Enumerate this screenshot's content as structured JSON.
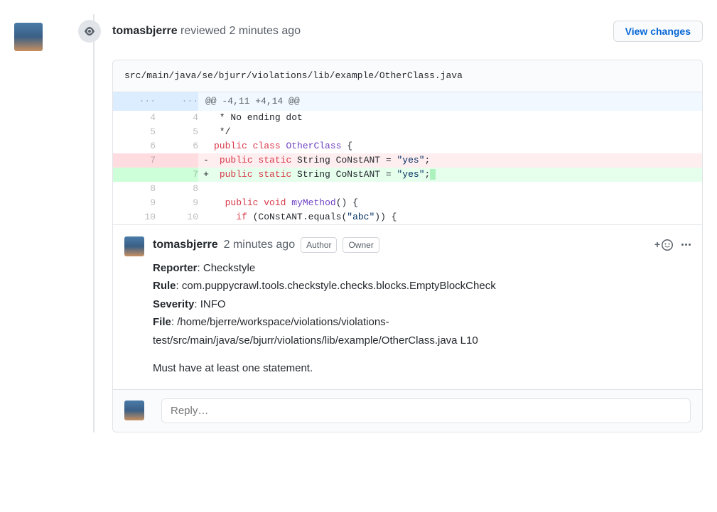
{
  "header": {
    "username": "tomasbjerre",
    "action": "reviewed",
    "time": "2 minutes ago",
    "viewChanges": "View changes"
  },
  "diff": {
    "filePath": "src/main/java/se/bjurr/violations/lib/example/OtherClass.java",
    "hunkEllipsis": "...",
    "hunkHeader": "@@ -4,11 +4,14 @@",
    "lines": [
      {
        "o": "4",
        "n": "4",
        "m": "",
        "t": "context",
        "parts": [
          " * No ending dot"
        ]
      },
      {
        "o": "5",
        "n": "5",
        "m": "",
        "t": "context",
        "parts": [
          " */"
        ]
      },
      {
        "o": "6",
        "n": "6",
        "m": "",
        "t": "context",
        "parts": [
          [
            "public",
            "k-public"
          ],
          [
            " ",
            ""
          ],
          [
            "class",
            "k-class"
          ],
          [
            " ",
            ""
          ],
          [
            "OtherClass",
            "k-type"
          ],
          [
            " {",
            ""
          ]
        ]
      },
      {
        "o": "7",
        "n": "",
        "m": "-",
        "t": "del",
        "parts": [
          [
            " ",
            ""
          ],
          [
            "public",
            "k-public"
          ],
          [
            " ",
            ""
          ],
          [
            "static",
            "k-static"
          ],
          [
            " String CoNstANT = ",
            ""
          ],
          [
            "\"yes\"",
            "k-str"
          ],
          [
            ";",
            ""
          ]
        ]
      },
      {
        "o": "",
        "n": "7",
        "m": "+",
        "t": "add",
        "parts": [
          [
            " ",
            ""
          ],
          [
            "public",
            "k-public"
          ],
          [
            " ",
            ""
          ],
          [
            "static",
            "k-static"
          ],
          [
            " String CoNstANT = ",
            ""
          ],
          [
            "\"yes\"",
            "k-str"
          ],
          [
            ";",
            ""
          ]
        ],
        "tail": " "
      },
      {
        "o": "8",
        "n": "8",
        "m": "",
        "t": "context",
        "parts": [
          ""
        ]
      },
      {
        "o": "9",
        "n": "9",
        "m": "",
        "t": "context",
        "parts": [
          [
            "  ",
            ""
          ],
          [
            "public",
            "k-public"
          ],
          [
            " ",
            ""
          ],
          [
            "void",
            "k-void"
          ],
          [
            " ",
            ""
          ],
          [
            "myMethod",
            "k-type"
          ],
          [
            "() {",
            ""
          ]
        ]
      },
      {
        "o": "10",
        "n": "10",
        "m": "",
        "t": "context",
        "parts": [
          [
            "    ",
            ""
          ],
          [
            "if",
            "k-if"
          ],
          [
            " (CoNstANT.equals(",
            ""
          ],
          [
            "\"abc\"",
            "k-str"
          ],
          [
            ")) {",
            ""
          ]
        ]
      }
    ]
  },
  "comment": {
    "username": "tomasbjerre",
    "time": "2 minutes ago",
    "badges": [
      "Author",
      "Owner"
    ],
    "labels": {
      "reporter": "Reporter",
      "rule": "Rule",
      "severity": "Severity",
      "file": "File"
    },
    "reporter": "Checkstyle",
    "rule": "com.puppycrawl.tools.checkstyle.checks.blocks.EmptyBlockCheck",
    "severity": "INFO",
    "file": "/home/bjerre/workspace/violations/violations-test/src/main/java/se/bjurr/violations/lib/example/OtherClass.java L10",
    "message": "Must have at least one statement."
  },
  "reply": {
    "placeholder": "Reply…"
  }
}
